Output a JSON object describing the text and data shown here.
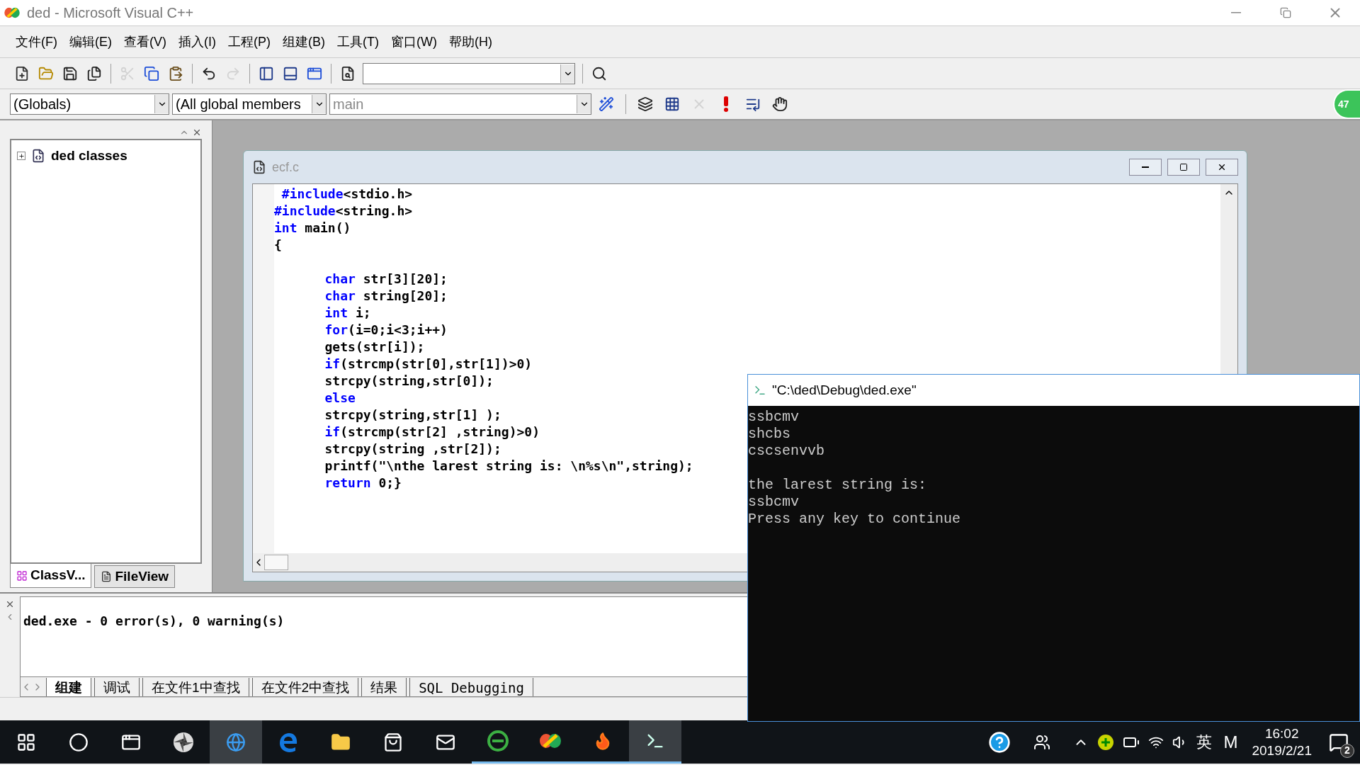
{
  "window": {
    "title": "ded - Microsoft Visual C++"
  },
  "menu": [
    {
      "label": "文件(F)"
    },
    {
      "label": "编辑(E)"
    },
    {
      "label": "查看(V)"
    },
    {
      "label": "插入(I)"
    },
    {
      "label": "工程(P)"
    },
    {
      "label": "组建(B)"
    },
    {
      "label": "工具(T)"
    },
    {
      "label": "窗口(W)"
    },
    {
      "label": "帮助(H)"
    }
  ],
  "toolbar": [
    {
      "kind": "new",
      "disabled": false
    },
    {
      "kind": "open",
      "disabled": false
    },
    {
      "kind": "save",
      "disabled": false
    },
    {
      "kind": "save_all",
      "disabled": false
    },
    {
      "kind": "separator"
    },
    {
      "kind": "cut",
      "disabled": true
    },
    {
      "kind": "copy",
      "disabled": false
    },
    {
      "kind": "paste",
      "disabled": false
    },
    {
      "kind": "separator"
    },
    {
      "kind": "undo",
      "disabled": false
    },
    {
      "kind": "redo",
      "disabled": true
    },
    {
      "kind": "separator"
    },
    {
      "kind": "workspace",
      "disabled": false
    },
    {
      "kind": "output",
      "disabled": false
    },
    {
      "kind": "windows",
      "disabled": false
    },
    {
      "kind": "separator"
    },
    {
      "kind": "find_in_files",
      "disabled": false
    },
    {
      "kind": "combo"
    },
    {
      "kind": "separator"
    },
    {
      "kind": "search",
      "disabled": false
    }
  ],
  "wizard_bar": {
    "class": "(Globals)",
    "members": "(All global members",
    "function": "main"
  },
  "build_toolbar": [
    {
      "kind": "wizard",
      "disabled": false
    },
    {
      "kind": "separator"
    },
    {
      "kind": "compile",
      "disabled": false
    },
    {
      "kind": "build",
      "disabled": false
    },
    {
      "kind": "stop",
      "disabled": true
    },
    {
      "kind": "execute",
      "disabled": false
    },
    {
      "kind": "step",
      "disabled": false
    },
    {
      "kind": "breakpoint",
      "disabled": false
    }
  ],
  "badge": "47",
  "workspace": {
    "tree": [
      {
        "label": "ded classes",
        "expanded": false
      }
    ],
    "tabs": [
      {
        "label": "ClassV...",
        "kind": "classview",
        "selected": true
      },
      {
        "label": "FileView",
        "kind": "fileview",
        "selected": false
      }
    ]
  },
  "editor": {
    "title": "ecf.c",
    "blocks": [
      [
        [
          {
            "text": " #include",
            "kind": "keyword"
          },
          {
            "text": "<stdio.h>",
            "kind": "plain"
          }
        ],
        [
          {
            "text": "#include",
            "kind": "keyword"
          },
          {
            "text": "<string.h>",
            "kind": "plain"
          }
        ],
        [
          {
            "text": "int",
            "kind": "keyword"
          },
          {
            "text": " main()",
            "kind": "plain"
          }
        ],
        [
          {
            "text": "{",
            "kind": "plain"
          }
        ]
      ],
      [
        [
          {
            "text": "\tchar",
            "kind": "keyword"
          },
          {
            "text": " str[3][20];",
            "kind": "plain"
          }
        ],
        [
          {
            "text": "\tchar",
            "kind": "keyword"
          },
          {
            "text": " string[20];",
            "kind": "plain"
          }
        ],
        [
          {
            "text": "\tint",
            "kind": "keyword"
          },
          {
            "text": " i;",
            "kind": "plain"
          }
        ],
        [
          {
            "text": "\tfor",
            "kind": "keyword"
          },
          {
            "text": "(i=0;i<3;i++)",
            "kind": "plain"
          }
        ],
        [
          {
            "text": "\tgets(str[i]);",
            "kind": "plain"
          }
        ],
        [
          {
            "text": "\tif",
            "kind": "keyword"
          },
          {
            "text": "(strcmp(str[0],str[1])>0)",
            "kind": "plain"
          }
        ],
        [
          {
            "text": "\tstrcpy(string,str[0]);",
            "kind": "plain"
          }
        ],
        [
          {
            "text": "\telse",
            "kind": "keyword"
          }
        ],
        [
          {
            "text": "\tstrcpy(string,str[1] );",
            "kind": "plain"
          }
        ],
        [
          {
            "text": "\tif",
            "kind": "keyword"
          },
          {
            "text": "(strcmp(str[2] ,string)>0)",
            "kind": "plain"
          }
        ],
        [
          {
            "text": "\tstrcpy(string ,str[2]);",
            "kind": "plain"
          }
        ],
        [
          {
            "text": "\tprintf(\"\\nthe larest string is: \\n%s\\n\",string);",
            "kind": "plain"
          }
        ],
        [
          {
            "text": "\treturn",
            "kind": "keyword"
          },
          {
            "text": " 0;}",
            "kind": "plain"
          }
        ]
      ]
    ]
  },
  "output": {
    "message": "ded.exe - 0 error(s), 0 warning(s)",
    "tabs": [
      {
        "label": "组建",
        "selected": true
      },
      {
        "label": "调试",
        "selected": false
      },
      {
        "label": "在文件1中查找",
        "selected": false
      },
      {
        "label": "在文件2中查找",
        "selected": false
      },
      {
        "label": "结果",
        "selected": false
      },
      {
        "label": "SQL Debugging",
        "selected": false
      }
    ]
  },
  "console": {
    "title": "\"C:\\ded\\Debug\\ded.exe\"",
    "blocks": [
      [
        "ssbcmv",
        "shcbs",
        "cscsenvvb"
      ],
      [
        "the larest string is:",
        "ssbcmv",
        "Press any key to continue"
      ]
    ]
  },
  "taskbar": {
    "apps": [
      {
        "kind": "start",
        "active": false,
        "running": false
      },
      {
        "kind": "cortana",
        "active": false,
        "running": false
      },
      {
        "kind": "taskview",
        "active": false,
        "running": false
      },
      {
        "kind": "pinwheel",
        "active": false,
        "running": false
      },
      {
        "kind": "ie",
        "active": true,
        "running": false
      },
      {
        "kind": "edge",
        "active": false,
        "running": false
      },
      {
        "kind": "explorer",
        "active": false,
        "running": false
      },
      {
        "kind": "store",
        "active": false,
        "running": false
      },
      {
        "kind": "mail",
        "active": false,
        "running": false
      },
      {
        "kind": "browser360",
        "active": false,
        "running": true
      },
      {
        "kind": "vc",
        "active": false,
        "running": true
      },
      {
        "kind": "firefox",
        "active": false,
        "running": true
      },
      {
        "kind": "console",
        "active": true,
        "running": true
      }
    ],
    "ime": "英",
    "ime_mode": "M",
    "time": "16:02",
    "date": "2019/2/21",
    "notifications": "2"
  }
}
